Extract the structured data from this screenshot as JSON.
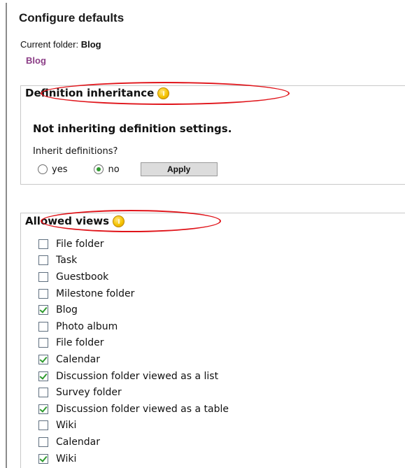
{
  "header": {
    "title": "Configure defaults",
    "current_folder_label": "Current folder:",
    "current_folder_name": "Blog",
    "folder_link": "Blog"
  },
  "inheritance": {
    "legend": "Definition inheritance",
    "status": "Not inheriting definition settings.",
    "question": "Inherit definitions?",
    "options": [
      {
        "label": "yes",
        "selected": false
      },
      {
        "label": "no",
        "selected": true
      }
    ],
    "apply_label": "Apply"
  },
  "views": {
    "legend": "Allowed views",
    "items": [
      {
        "label": "File folder",
        "checked": false
      },
      {
        "label": "Task",
        "checked": false
      },
      {
        "label": "Guestbook",
        "checked": false
      },
      {
        "label": "Milestone folder",
        "checked": false
      },
      {
        "label": "Blog",
        "checked": true
      },
      {
        "label": "Photo album",
        "checked": false
      },
      {
        "label": "File folder",
        "checked": false
      },
      {
        "label": "Calendar",
        "checked": true
      },
      {
        "label": "Discussion folder viewed as a list",
        "checked": true
      },
      {
        "label": "Survey folder",
        "checked": false
      },
      {
        "label": "Discussion folder viewed as a table",
        "checked": true
      },
      {
        "label": "Wiki",
        "checked": false
      },
      {
        "label": "Calendar",
        "checked": false
      },
      {
        "label": "Wiki",
        "checked": true
      }
    ]
  },
  "icons": {
    "info": "info-icon"
  },
  "colors": {
    "link": "#8b3d86",
    "annotation": "#e0141a",
    "check": "#2d9a2d",
    "info_icon": "#f5c400"
  }
}
